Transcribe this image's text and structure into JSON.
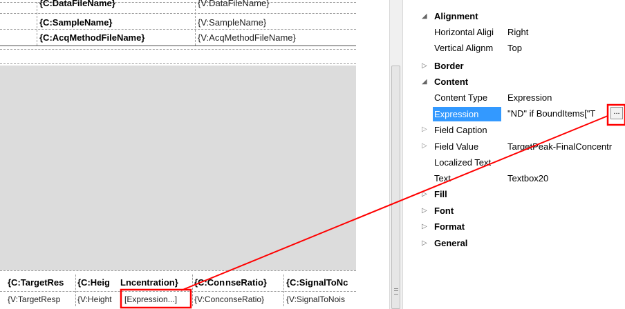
{
  "designer": {
    "header_rows": [
      {
        "caption": "{C:DataFileName}",
        "value": "{V:DataFileName}"
      },
      {
        "caption": "{C:SampleName}",
        "value": "{V:SampleName}"
      },
      {
        "caption": "{C:AcqMethodFileName}",
        "value": "{V:AcqMethodFileName}"
      }
    ],
    "caption_cells": [
      "{C:TargetRes",
      "{C:Heig",
      "Lncentration}",
      "{C:Con",
      "nseRatio}",
      "{C:SignalToNc"
    ],
    "value_cells": [
      "{V:TargetResp",
      "{V:Height",
      "[Expression...]",
      "{V:Conc",
      "onseRatio}",
      "{V:SignalToNois"
    ]
  },
  "properties": {
    "categories": [
      {
        "label": "Alignment",
        "expanded": true,
        "props": [
          {
            "name": "Horizontal Aligi",
            "value": "Right"
          },
          {
            "name": "Vertical Alignm",
            "value": "Top"
          }
        ]
      },
      {
        "label": "Border",
        "expanded": false,
        "props": []
      },
      {
        "label": "Content",
        "expanded": true,
        "props": [
          {
            "name": "Content Type",
            "value": "Expression"
          },
          {
            "name": "Expression",
            "value": "\"ND\" if BoundItems[\"T",
            "selected": true,
            "button": "..."
          },
          {
            "name": "Field Caption",
            "value": "",
            "expandable": true
          },
          {
            "name": "Field Value",
            "value": "TargetPeak-FinalConcentr",
            "expandable": true
          },
          {
            "name": "Localized Text",
            "value": ""
          },
          {
            "name": "Text",
            "value": "Textbox20"
          }
        ]
      },
      {
        "label": "Fill",
        "expanded": false,
        "props": []
      },
      {
        "label": "Font",
        "expanded": false,
        "props": []
      },
      {
        "label": "Format",
        "expanded": false,
        "props": []
      },
      {
        "label": "General",
        "expanded": false,
        "props": []
      }
    ]
  },
  "icons": {
    "expanded_toggle": "triangle-down-icon",
    "collapsed_toggle": "triangle-right-icon",
    "grip": "scroll-grip-icon"
  },
  "colors": {
    "selection": "#3399ff",
    "annotation": "#ff0000",
    "design_surface_gray": "#dcdcdc"
  }
}
